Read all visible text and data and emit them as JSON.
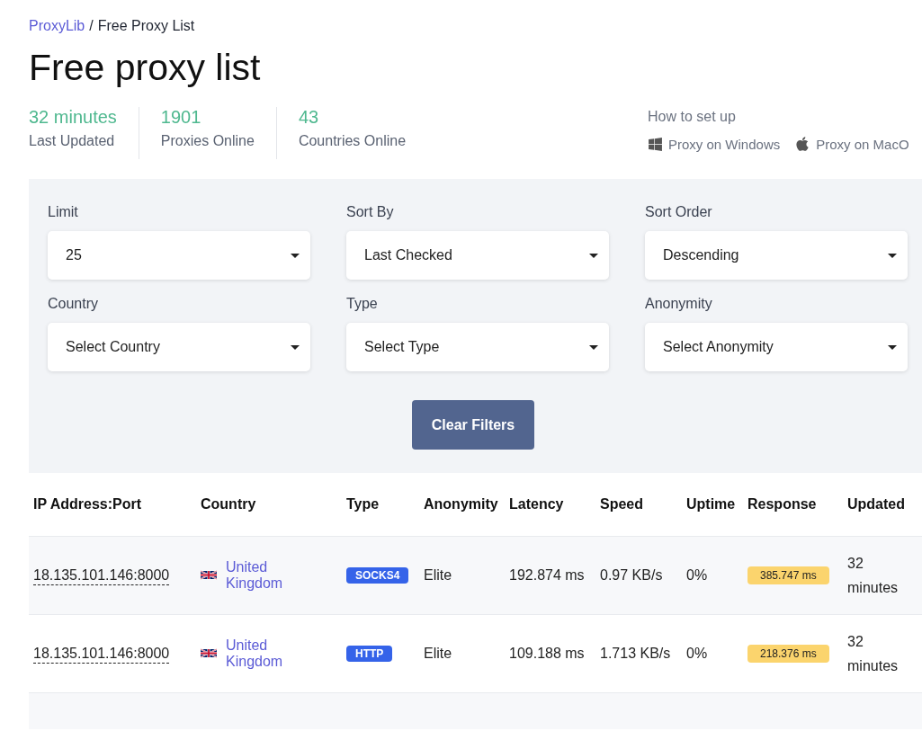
{
  "breadcrumb": {
    "link": "ProxyLib",
    "separator": "/",
    "current": "Free Proxy List"
  },
  "title": "Free proxy list",
  "stats": [
    {
      "value": "32 minutes",
      "label": "Last Updated"
    },
    {
      "value": "1901",
      "label": "Proxies Online"
    },
    {
      "value": "43",
      "label": "Countries Online"
    }
  ],
  "setup": {
    "heading": "How to set up",
    "links": [
      {
        "kind": "windows",
        "label": "Proxy on Windows"
      },
      {
        "kind": "apple",
        "label": "Proxy on MacO"
      }
    ]
  },
  "filters": [
    {
      "label": "Limit",
      "value": "25"
    },
    {
      "label": "Sort By",
      "value": "Last Checked"
    },
    {
      "label": "Sort Order",
      "value": "Descending"
    },
    {
      "label": "Country",
      "value": "Select Country"
    },
    {
      "label": "Type",
      "value": "Select Type"
    },
    {
      "label": "Anonymity",
      "value": "Select Anonymity"
    }
  ],
  "clear_button": "Clear Filters",
  "table": {
    "columns": [
      "IP Address:Port",
      "Country",
      "Type",
      "Anonymity",
      "Latency",
      "Speed",
      "Uptime",
      "Response",
      "Updated"
    ],
    "rows": [
      {
        "ip": "18.135.101.146:8000",
        "country": "United Kingdom",
        "type": "SOCKS4",
        "anonymity": "Elite",
        "latency": "192.874 ms",
        "speed": "0.97 KB/s",
        "uptime": "0%",
        "response": "385.747 ms",
        "updated": "32 minutes"
      },
      {
        "ip": "18.135.101.146:8000",
        "country": "United Kingdom",
        "type": "HTTP",
        "anonymity": "Elite",
        "latency": "109.188 ms",
        "speed": "1.713 KB/s",
        "uptime": "0%",
        "response": "218.376 ms",
        "updated": "32 minutes"
      }
    ]
  }
}
